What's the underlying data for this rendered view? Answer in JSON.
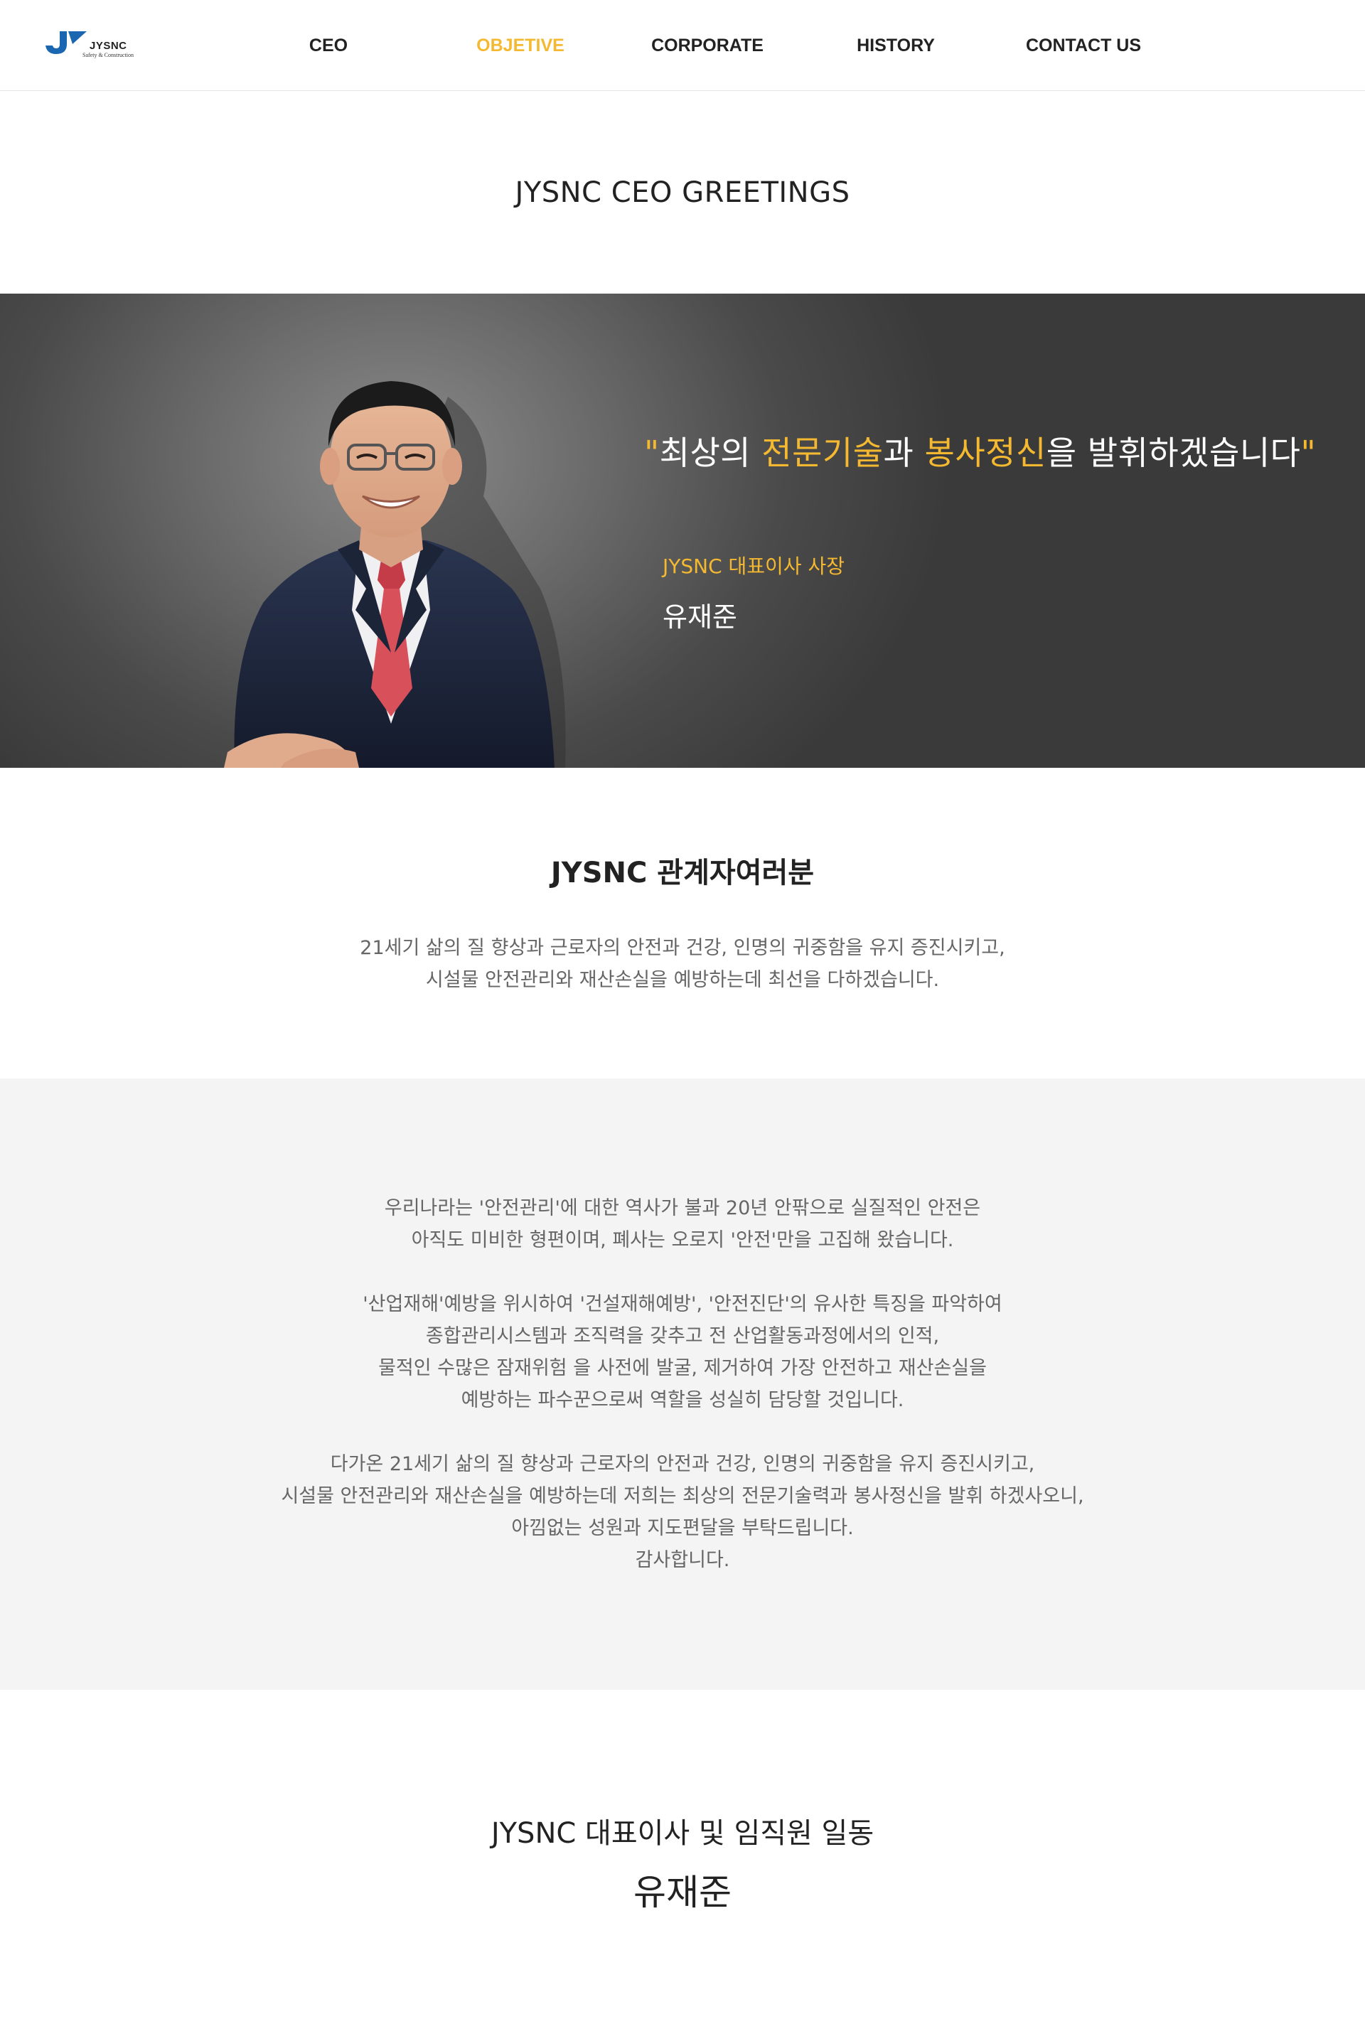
{
  "header": {
    "logo_text": "JYSNC",
    "logo_subtext": "Safety & Construction",
    "nav": [
      {
        "label": "CEO"
      },
      {
        "label": "OBJETIVE"
      },
      {
        "label": "CORPORATE"
      },
      {
        "label": "HISTORY"
      },
      {
        "label": "CONTACT US"
      }
    ]
  },
  "page_title": "JYSNC CEO GREETINGS",
  "hero": {
    "quote_open": "\"",
    "quote_part1": "최상의 ",
    "quote_hl1": "전문기술",
    "quote_part2": "과 ",
    "quote_hl2": "봉사정신",
    "quote_part3": "을 발휘하겠습니다",
    "quote_close": "\"",
    "role": "JYSNC 대표이사 사장",
    "name": "유재준"
  },
  "intro": {
    "heading": "JYSNC 관계자여러분",
    "lines": [
      "21세기 삶의 질 향상과 근로자의 안전과 건강, 인명의 귀중함을 유지 증진시키고,",
      "시설물 안전관리와 재산손실을 예방하는데 최선을 다하겠습니다."
    ]
  },
  "message": {
    "paragraphs": [
      [
        "우리나라는 '안전관리'에 대한 역사가 불과 20년 안팎으로 실질적인 안전은",
        "아직도 미비한 형편이며, 폐사는 오로지 '안전'만을 고집해 왔습니다."
      ],
      [
        "'산업재해'예방을 위시하여 '건설재해예방', '안전진단'의 유사한 특징을 파악하여",
        "종합관리시스템과 조직력을 갖추고 전 산업활동과정에서의 인적,",
        "물적인 수많은 잠재위험 을 사전에 발굴, 제거하여 가장 안전하고 재산손실을",
        "예방하는 파수꾼으로써 역할을 성실히 담당할 것입니다."
      ],
      [
        "다가온 21세기 삶의 질 향상과 근로자의 안전과 건강, 인명의 귀중함을 유지 증진시키고,",
        "시설물 안전관리와 재산손실을 예방하는데 저희는 최상의 전문기술력과 봉사정신을 발휘 하겠사오니,",
        "아낌없는 성원과 지도편달을 부탁드립니다.",
        "감사합니다."
      ]
    ]
  },
  "signoff": {
    "line": "JYSNC 대표이사 및 임직원 일동",
    "name": "유재준"
  },
  "colors": {
    "accent": "#f5b931",
    "logo_blue": "#1b66b1",
    "hero_dark": "#3a3a3a",
    "message_bg": "#f4f4f4"
  }
}
